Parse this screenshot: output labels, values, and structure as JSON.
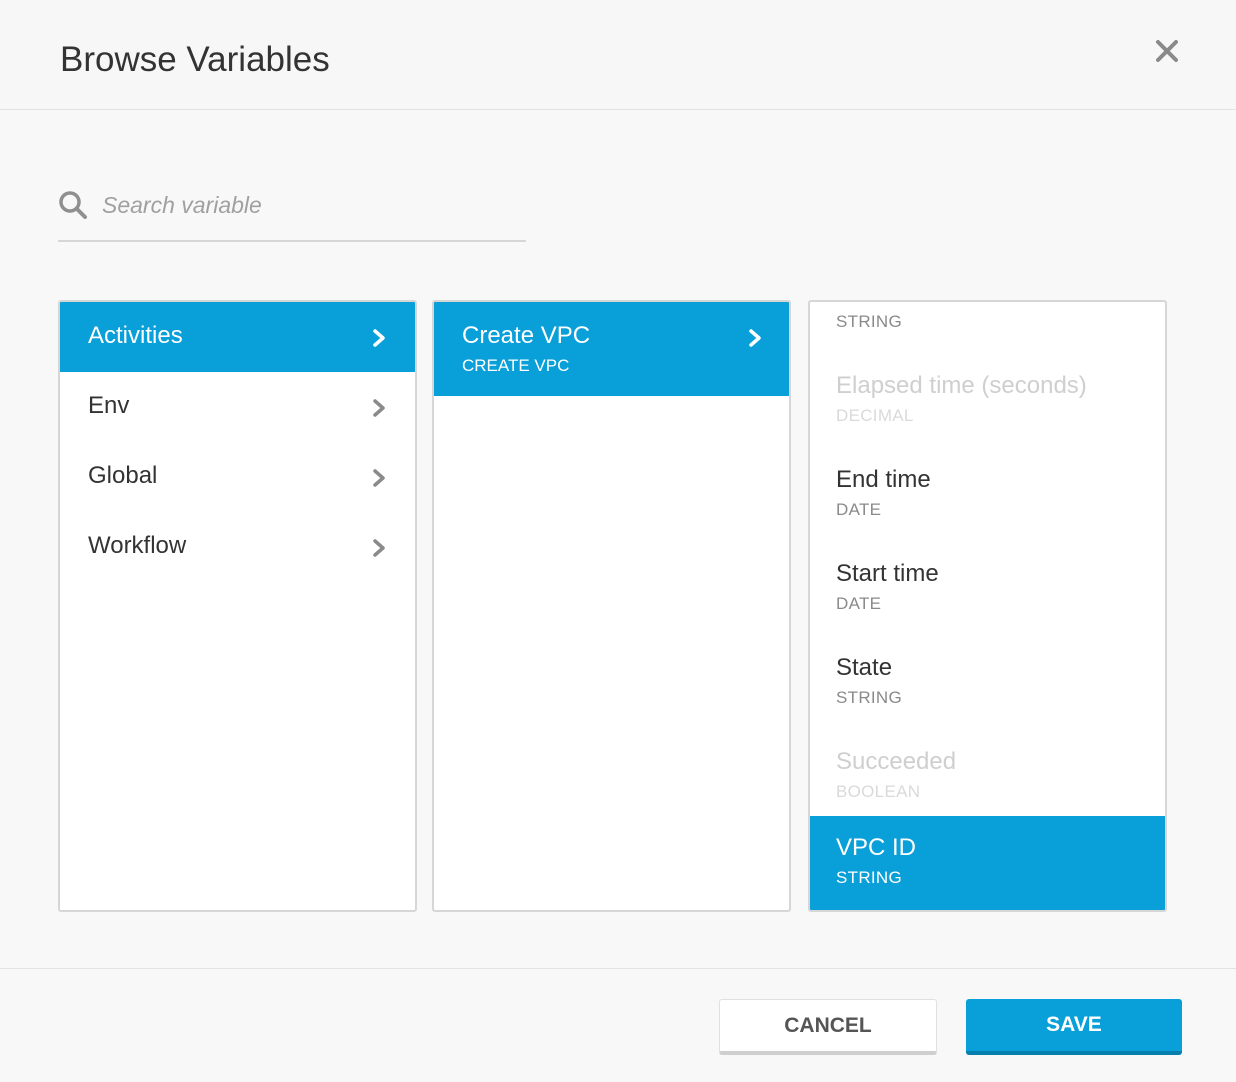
{
  "dialog": {
    "title": "Browse Variables"
  },
  "search": {
    "placeholder": "Search variable",
    "value": ""
  },
  "categories": [
    {
      "label": "Activities",
      "selected": true
    },
    {
      "label": "Env",
      "selected": false
    },
    {
      "label": "Global",
      "selected": false
    },
    {
      "label": "Workflow",
      "selected": false
    }
  ],
  "activities": [
    {
      "label": "Create VPC",
      "sublabel": "CREATE VPC",
      "selected": true
    }
  ],
  "variables": [
    {
      "name": "",
      "type": "STRING",
      "disabled": false,
      "selected": false
    },
    {
      "name": "Elapsed time (seconds)",
      "type": "DECIMAL",
      "disabled": true,
      "selected": false
    },
    {
      "name": "End time",
      "type": "DATE",
      "disabled": false,
      "selected": false
    },
    {
      "name": "Start time",
      "type": "DATE",
      "disabled": false,
      "selected": false
    },
    {
      "name": "State",
      "type": "STRING",
      "disabled": false,
      "selected": false
    },
    {
      "name": "Succeeded",
      "type": "BOOLEAN",
      "disabled": true,
      "selected": false
    },
    {
      "name": "VPC ID",
      "type": "STRING",
      "disabled": false,
      "selected": true
    }
  ],
  "footer": {
    "cancel_label": "CANCEL",
    "save_label": "SAVE"
  },
  "colors": {
    "accent": "#099fd8",
    "border": "#d6d6d6"
  },
  "icons": {
    "close": "close-icon",
    "search": "search-icon",
    "chevron": "chevron-right-icon"
  }
}
